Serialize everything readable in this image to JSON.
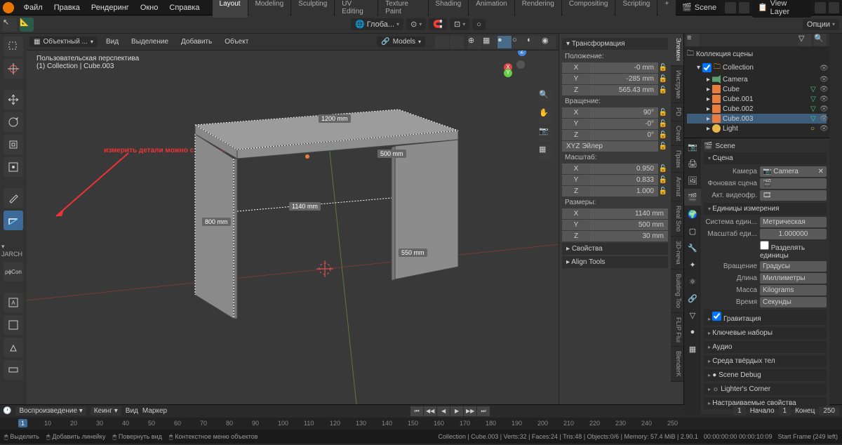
{
  "menubar": {
    "items": [
      "Файл",
      "Правка",
      "Рендеринг",
      "Окно",
      "Справка"
    ],
    "tabs": [
      "Layout",
      "Modeling",
      "Sculpting",
      "UV Editing",
      "Texture Paint",
      "Shading",
      "Animation",
      "Rendering",
      "Compositing",
      "Scripting"
    ],
    "add_tab": "+",
    "scene_label": "Scene",
    "viewlayer_label": "View Layer"
  },
  "toolbar2": {
    "global_label": "Глоба...",
    "options_label": "Опции"
  },
  "header3": {
    "mode": "Объектный ...",
    "view": "Вид",
    "select": "Выделение",
    "add": "Добавить",
    "object": "Объект",
    "models": "Models"
  },
  "viewport": {
    "perspective": "Пользовательская перспектива",
    "collection": "(1) Collection | Cube.003",
    "annotation_text": "измерить детали можно с помощью рулетки",
    "dims": {
      "d1200": "1200  mm",
      "d500": "500  mm",
      "d1140": "1140  mm",
      "d800": "800  mm",
      "d550": "550  mm"
    }
  },
  "leftcol": {
    "jarch": "JARCH",
    "con": "ρϕCon"
  },
  "npanel": {
    "tabs": [
      "Элемен",
      "Инструме",
      "PD",
      "Creat",
      "Правк",
      "Animat",
      "Real Sno",
      "3D-печа",
      "Building Too",
      "FLIP Flui",
      "BlenderK"
    ],
    "transform_hdr": "Трансформация",
    "location_label": "Положение:",
    "loc": {
      "x": "X",
      "y": "Y",
      "z": "Z",
      "xv": "-0 mm",
      "yv": "-285 mm",
      "zv": "565.43 mm"
    },
    "rotation_label": "Вращение:",
    "rot": {
      "x": "X",
      "y": "Y",
      "z": "Z",
      "xv": "90°",
      "yv": "-0°",
      "zv": "0°"
    },
    "rot_mode": "XYZ Эйлер",
    "scale_label": "Масштаб:",
    "scale": {
      "x": "X",
      "y": "Y",
      "z": "Z",
      "xv": "0.950",
      "yv": "0.833",
      "zv": "1.000"
    },
    "dims_label": "Размеры:",
    "dims": {
      "x": "X",
      "y": "Y",
      "z": "Z",
      "xv": "1140 mm",
      "yv": "500 mm",
      "zv": "30 mm"
    },
    "props_hdr": "Свойства",
    "align_hdr": "Align Tools"
  },
  "outliner": {
    "root": "Коллекция сцены",
    "collection": "Collection",
    "items": [
      {
        "name": "Camera",
        "type": "cam"
      },
      {
        "name": "Cube",
        "type": "mesh"
      },
      {
        "name": "Cube.001",
        "type": "mesh"
      },
      {
        "name": "Cube.002",
        "type": "mesh"
      },
      {
        "name": "Cube.003",
        "type": "mesh",
        "selected": true
      },
      {
        "name": "Light",
        "type": "light"
      }
    ]
  },
  "props": {
    "scene_crumb": "Scene",
    "scene_hdr": "Сцена",
    "camera_lbl": "Камера",
    "camera_val": "Camera",
    "bgscene_lbl": "Фоновая сцена",
    "activeclip_lbl": "Акт. видеофр.",
    "units_hdr": "Единицы измерения",
    "unit_sys_lbl": "Система един...",
    "unit_sys_val": "Метрическая",
    "unit_scale_lbl": "Масштаб еди...",
    "unit_scale_val": "1.000000",
    "separate_units": "Разделять единицы",
    "rotation_lbl": "Вращение",
    "rotation_val": "Градусы",
    "length_lbl": "Длина",
    "length_val": "Миллиметры",
    "mass_lbl": "Масса",
    "mass_val": "Kilograms",
    "time_lbl": "Время",
    "time_val": "Секунды",
    "gravity_hdr": "Гравитация",
    "keysets_hdr": "Ключевые наборы",
    "audio_hdr": "Аудио",
    "rigid_hdr": "Среда твёрдых тел",
    "debug_hdr": "Scene Debug",
    "lighter_hdr": "Lighter's Corner",
    "custom_hdr": "Настраиваемые свойства"
  },
  "timeline": {
    "playback": "Воспроизведение",
    "keying": "Кеинг",
    "view": "Вид",
    "marker": "Маркер",
    "current": "1",
    "start_lbl": "Начало",
    "start": "1",
    "end_lbl": "Конец",
    "end": "250",
    "ticks": [
      "1",
      "10",
      "20",
      "30",
      "40",
      "50",
      "60",
      "70",
      "80",
      "90",
      "100",
      "110",
      "120",
      "130",
      "140",
      "150",
      "160",
      "170",
      "180",
      "190",
      "200",
      "210",
      "220",
      "230",
      "240",
      "250"
    ]
  },
  "status": {
    "select": "Выделить",
    "add_measure": "Добавить линейку",
    "rotate": "Повернуть вид",
    "context_menu": "Контекстное меню объектов",
    "stats": "Collection | Cube.003 | Verts:32 | Faces:24 | Tris:48 | Objects:0/6 | Memory: 57.4 MiB | 2.90.1",
    "time": "00:00:00:00  00:00:10:09",
    "frame": "Start Frame (249 left)"
  }
}
